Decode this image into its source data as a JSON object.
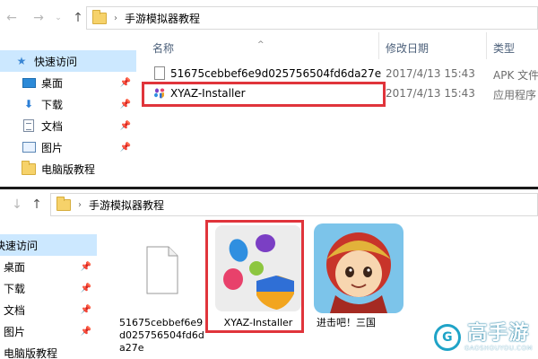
{
  "window_top": {
    "breadcrumb": {
      "folder": "手游模拟器教程"
    },
    "sidebar": {
      "quick_access": "快速访问",
      "items": [
        {
          "label": "桌面",
          "pinned": true
        },
        {
          "label": "下载",
          "pinned": true
        },
        {
          "label": "文档",
          "pinned": true
        },
        {
          "label": "图片",
          "pinned": true
        },
        {
          "label": "电脑版教程",
          "pinned": false
        }
      ]
    },
    "columns": {
      "name": "名称",
      "date": "修改日期",
      "type": "类型"
    },
    "files": [
      {
        "name": "51675cebbef6e9d025756504fd6da27e",
        "date": "2017/4/13 15:43",
        "type": "APK 文件"
      },
      {
        "name": "XYAZ-Installer",
        "date": "2017/4/13 15:43",
        "type": "应用程序"
      }
    ]
  },
  "window_bottom": {
    "breadcrumb": {
      "folder": "手游模拟器教程"
    },
    "sidebar": {
      "quick_access": "快速访问",
      "items": [
        {
          "label": "桌面",
          "pinned": true
        },
        {
          "label": "下载",
          "pinned": true
        },
        {
          "label": "文档",
          "pinned": true
        },
        {
          "label": "图片",
          "pinned": true
        },
        {
          "label": "电脑版教程",
          "pinned": false
        }
      ]
    },
    "tiles": [
      {
        "label": "51675cebbef6e9d025756504fd6da27e"
      },
      {
        "label": "XYAZ-Installer"
      },
      {
        "label": "进击吧！三国"
      }
    ]
  },
  "watermark": {
    "brand": "高手游",
    "url": "GAOSHOUYOU.COM"
  },
  "colors": {
    "highlight": "#e0343b",
    "selected": "#cce8ff",
    "accent": "#1fa3c7"
  }
}
